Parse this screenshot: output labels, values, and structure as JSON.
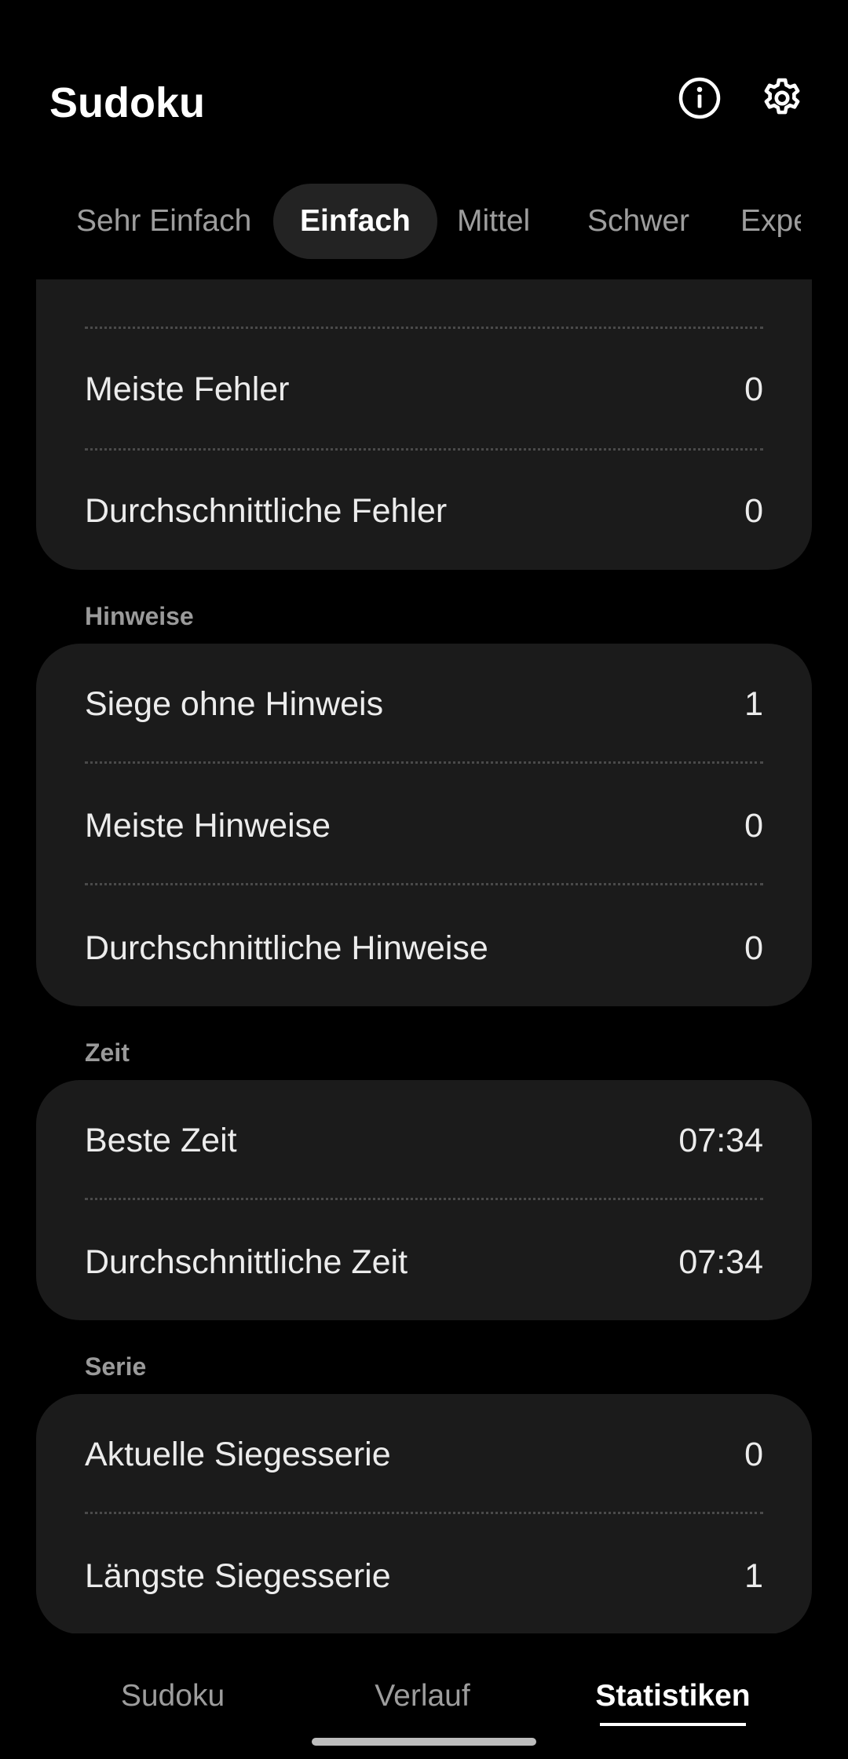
{
  "app": {
    "title": "Sudoku"
  },
  "header_icons": {
    "info": "info-icon",
    "settings": "gear-icon"
  },
  "tabs": [
    {
      "label": "Sehr Einfach",
      "active": false
    },
    {
      "label": "Einfach",
      "active": true
    },
    {
      "label": "Mittel",
      "active": false
    },
    {
      "label": "Schwer",
      "active": false
    },
    {
      "label": "Experte",
      "active": false
    }
  ],
  "fehler_card": {
    "rows": [
      {
        "label": "Meiste Fehler",
        "value": "0"
      },
      {
        "label": "Durchschnittliche Fehler",
        "value": "0"
      }
    ]
  },
  "hinweise": {
    "title": "Hinweise",
    "rows": [
      {
        "label": "Siege ohne Hinweis",
        "value": "1"
      },
      {
        "label": "Meiste Hinweise",
        "value": "0"
      },
      {
        "label": "Durchschnittliche Hinweise",
        "value": "0"
      }
    ]
  },
  "zeit": {
    "title": "Zeit",
    "rows": [
      {
        "label": "Beste Zeit",
        "value": "07:34"
      },
      {
        "label": "Durchschnittliche Zeit",
        "value": "07:34"
      }
    ]
  },
  "serie": {
    "title": "Serie",
    "rows": [
      {
        "label": "Aktuelle Siegesserie",
        "value": "0"
      },
      {
        "label": "Längste Siegesserie",
        "value": "1"
      }
    ]
  },
  "bottom_nav": [
    {
      "label": "Sudoku",
      "active": false
    },
    {
      "label": "Verlauf",
      "active": false
    },
    {
      "label": "Statistiken",
      "active": true
    }
  ],
  "colors": {
    "background": "#000000",
    "card": "#1b1b1b",
    "active_tab": "#232323",
    "muted_text": "#9d9d9d"
  }
}
